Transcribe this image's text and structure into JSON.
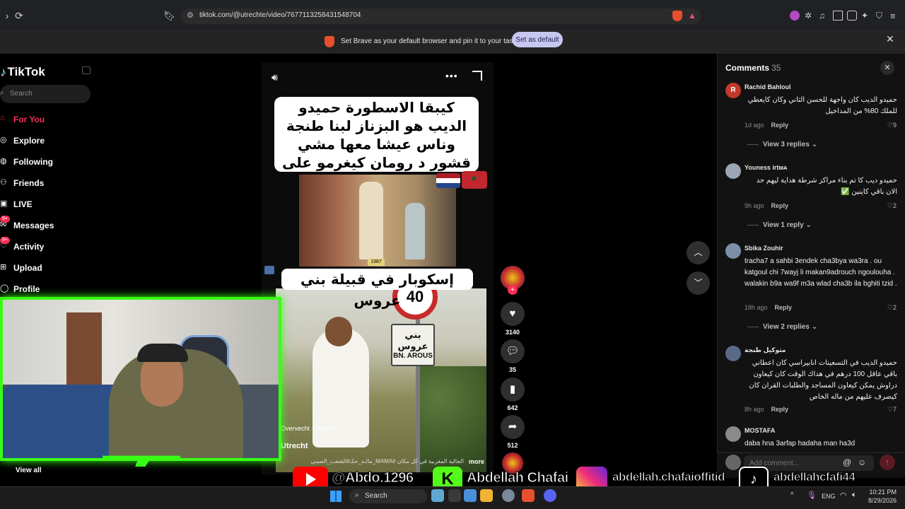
{
  "browser": {
    "url": "tiktok.com/@utrechte/video/7677113258431548704",
    "banner_text": "Set Brave as your default browser and pin it to your taskbar",
    "banner_button": "Set as default"
  },
  "sidebar": {
    "logo": "TikTok",
    "search_placeholder": "Search",
    "items": [
      {
        "label": "For You",
        "icon": "home-icon",
        "active": true
      },
      {
        "label": "Explore",
        "icon": "compass-icon"
      },
      {
        "label": "Following",
        "icon": "following-icon"
      },
      {
        "label": "Friends",
        "icon": "friends-icon"
      },
      {
        "label": "LIVE",
        "icon": "live-icon"
      },
      {
        "label": "Messages",
        "icon": "message-icon",
        "badge": "9+"
      },
      {
        "label": "Activity",
        "icon": "activity-icon",
        "badge": "9+"
      },
      {
        "label": "Upload",
        "icon": "upload-icon"
      },
      {
        "label": "Profile",
        "icon": "profile-icon"
      }
    ],
    "view_all": "View all"
  },
  "video": {
    "caption_top": "كيبقا الاسطورة حميدو الديب هو البزناز لبنا طنجة وناس عيشا معها مشي قشور د رومان كيغرمو على شيخات",
    "year_tag": "1987",
    "caption_bottom": "إسكوبار في قبيلة بني عروس",
    "speed_sign": "40",
    "town_sign_ar": "بني عروس",
    "town_sign_lat": "BN. AROUS",
    "location": "Overvecht - Utrecht",
    "author": "Utrecht",
    "description": "الجالية المغربية في كل مكان #MAMA_مالـه_حكـ#الشعب_الصيني",
    "more": "more"
  },
  "actions": {
    "likes": "3140",
    "comments": "35",
    "saves": "642",
    "shares": "512"
  },
  "comments": {
    "title": "Comments",
    "count": "35",
    "input_placeholder": "Add comment...",
    "items": [
      {
        "user": "Rachid Bahloul",
        "avatar_letter": "R",
        "avatar_color": "#c0392b",
        "text": "حميدو الديب كان واجهة للحسن الثاني وكان كايعطي للملك 80% من المداخيل",
        "rtl": true,
        "time": "1d ago",
        "reply": "Reply",
        "likes": "9",
        "view_replies": "View 3 replies"
      },
      {
        "user": "Youness irtᴍᴀ",
        "avatar_color": "#9aa7b2",
        "text": "حميدو ديب كا تم بناء مراكز شرطة هداية ليهم حد الان باقي كاينين ✅",
        "rtl": true,
        "time": "9h ago",
        "reply": "Reply",
        "likes": "2",
        "view_replies": "View 1 reply"
      },
      {
        "user": "Sbika Zouhir",
        "avatar_color": "#7d8fa8",
        "text": "tracha7 a sahbi 3endek cha3bya wa3ra . ou katgoul chi 7wayj li makan9adrouch ngoulouha . walakin b9a wa9f m3a wlad cha3b ila bghiti tzid .",
        "rtl": false,
        "time": "18h ago",
        "reply": "Reply",
        "likes": "2",
        "view_replies": "View 2 replies"
      },
      {
        "user": "متوكيل طنجة",
        "avatar_color": "#5a6a86",
        "text": "حميدو الديب في التسعينات انابيراسي كان اعطاني باقي عاقل 100 درهم في هداك الوقت كان كيعاون دراوش يمكن كيعاون المساجد والطلبات القران كان كيصرف عليهم من ماله الخاص",
        "rtl": true,
        "time": "8h ago",
        "reply": "Reply",
        "likes": "7"
      },
      {
        "user": "MOSTAFA",
        "avatar_color": "#8a8a8a",
        "text": "daba hna 3arfap hadaha man ha3d",
        "rtl": false
      }
    ]
  },
  "overlay": {
    "youtube": "@Abdo.1296",
    "kick": "Abdellah Chafai",
    "instagram": "abdellah.chafaioffitid",
    "tiktok": "abdellahcfafi44"
  },
  "taskbar": {
    "search": "Search",
    "lang": "ENG",
    "time": "10:21 PM",
    "date": "8/29/2026"
  },
  "colors": {
    "accent": "#fe2c55",
    "webcam_frame": "#39ff14"
  }
}
